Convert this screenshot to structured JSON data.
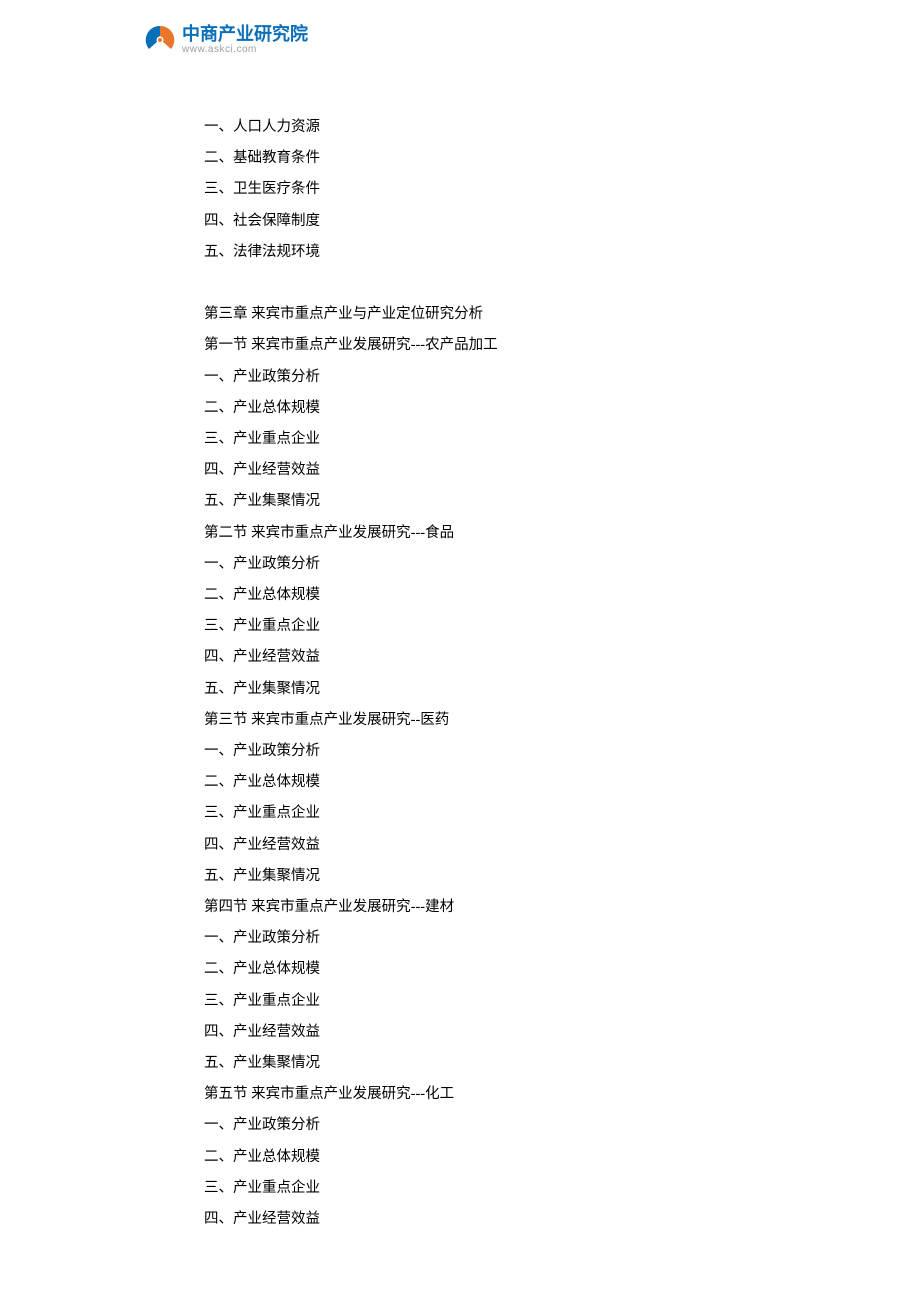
{
  "logo": {
    "cn": "中商产业研究院",
    "en": "www.askci.com"
  },
  "lines": [
    "一、人口人力资源",
    "二、基础教育条件",
    "三、卫生医疗条件",
    "四、社会保障制度",
    "五、法律法规环境",
    "",
    "第三章 来宾市重点产业与产业定位研究分析",
    "第一节 来宾市重点产业发展研究---农产品加工",
    "一、产业政策分析",
    "二、产业总体规模",
    "三、产业重点企业",
    "四、产业经营效益",
    "五、产业集聚情况",
    "第二节 来宾市重点产业发展研究---食品",
    "一、产业政策分析",
    "二、产业总体规模",
    "三、产业重点企业",
    "四、产业经营效益",
    "五、产业集聚情况",
    "第三节 来宾市重点产业发展研究--医药",
    "一、产业政策分析",
    "二、产业总体规模",
    "三、产业重点企业",
    "四、产业经营效益",
    "五、产业集聚情况",
    "第四节 来宾市重点产业发展研究---建材",
    "一、产业政策分析",
    "二、产业总体规模",
    "三、产业重点企业",
    "四、产业经营效益",
    "五、产业集聚情况",
    "第五节 来宾市重点产业发展研究---化工",
    "一、产业政策分析",
    "二、产业总体规模",
    "三、产业重点企业",
    "四、产业经营效益"
  ]
}
